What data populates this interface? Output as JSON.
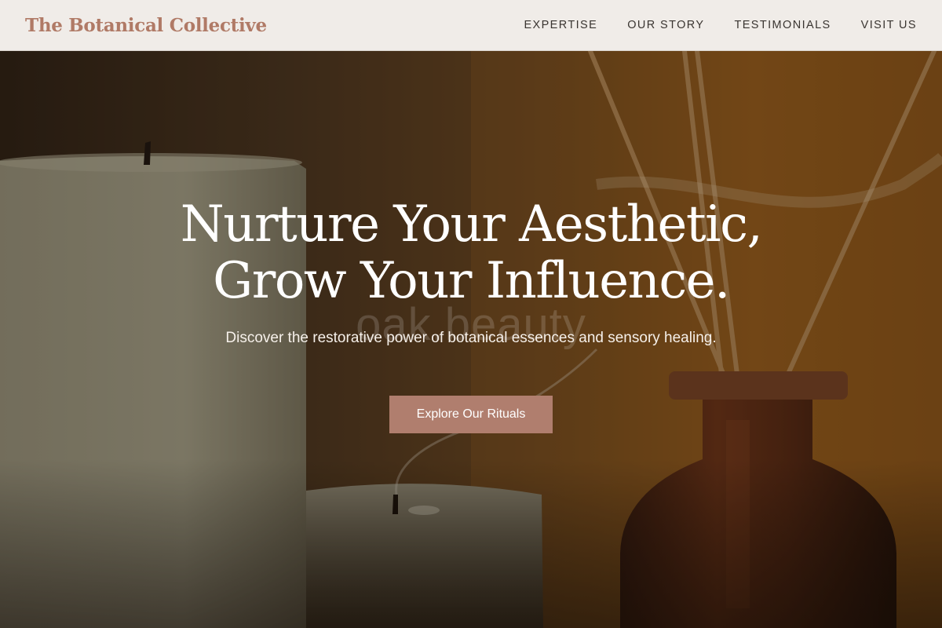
{
  "header": {
    "brand": "The Botanical Collective",
    "nav": [
      {
        "label": "EXPERTISE"
      },
      {
        "label": "OUR STORY"
      },
      {
        "label": "TESTIMONIALS"
      },
      {
        "label": "VISIT US"
      }
    ]
  },
  "hero": {
    "title_line1": "Nurture Your Aesthetic,",
    "title_line2": "Grow Your Influence.",
    "subtitle": "Discover the restorative power of botanical essences and sensory healing.",
    "cta_label": "Explore Our Rituals",
    "watermark": "oak.beauty"
  },
  "colors": {
    "brand": "#b07a66",
    "header_bg": "#f0ece8",
    "cta_bg": "#b07e6e",
    "nav_text": "#3a3531"
  }
}
